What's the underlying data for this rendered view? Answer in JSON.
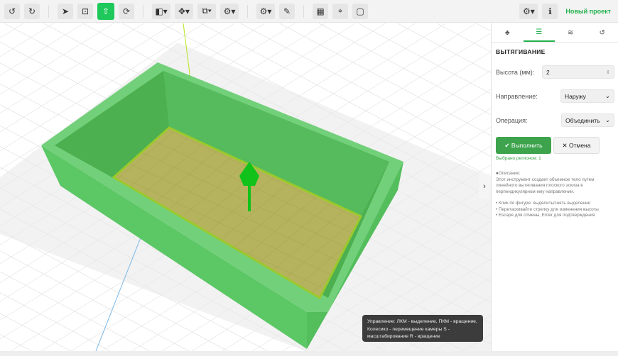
{
  "toolbar": {
    "undo": "↺",
    "redo": "↻",
    "select": "➤",
    "sketch": "⊡",
    "extrude": "⇧",
    "rotate": "⟳",
    "boolean": "◧▾",
    "move": "✥▾",
    "copy": "⧉▾",
    "mods": "⚙▾",
    "settings": "⚙▾",
    "measure": "✎",
    "grid": "▦",
    "snap": "⌖",
    "frame": "▢",
    "gear": "⚙▾",
    "info": "ℹ",
    "project_name": "Новый проект"
  },
  "panel": {
    "tabs": [
      {
        "icon": "♣"
      },
      {
        "icon": "☰"
      },
      {
        "icon": "≋"
      },
      {
        "icon": "↺"
      }
    ],
    "title": "ВЫТЯГИВАНИЕ",
    "height_label": "Высота (мм):",
    "height_value": "2",
    "direction_label": "Направление:",
    "direction_value": "Наружу",
    "operation_label": "Операция:",
    "operation_value": "Объединить",
    "execute": "✔ Выполнить",
    "cancel": "✕ Отмена",
    "selected": "Выбрано регионов: 1",
    "desc_title": "Описание:",
    "desc_text": "Этот инструмент создает объемное тело путем линейного вытягивания плоского эскиза в перпендикулярном ему направлении.",
    "hints": [
      "• Клик по фигуре: выделить/снять выделение",
      "• Перетаскивайте стрелку для изменения высоты",
      "• Escape для отмены, Enter для подтверждения"
    ]
  },
  "tooltip": "Управление: ЛКМ - выделение, ПКМ - вращение, Колесико - перемещение камеры S - масштабирование R - вращение",
  "colors": {
    "accent": "#1ec85a",
    "box": "#5cc765",
    "floor": "#b8b25a"
  }
}
